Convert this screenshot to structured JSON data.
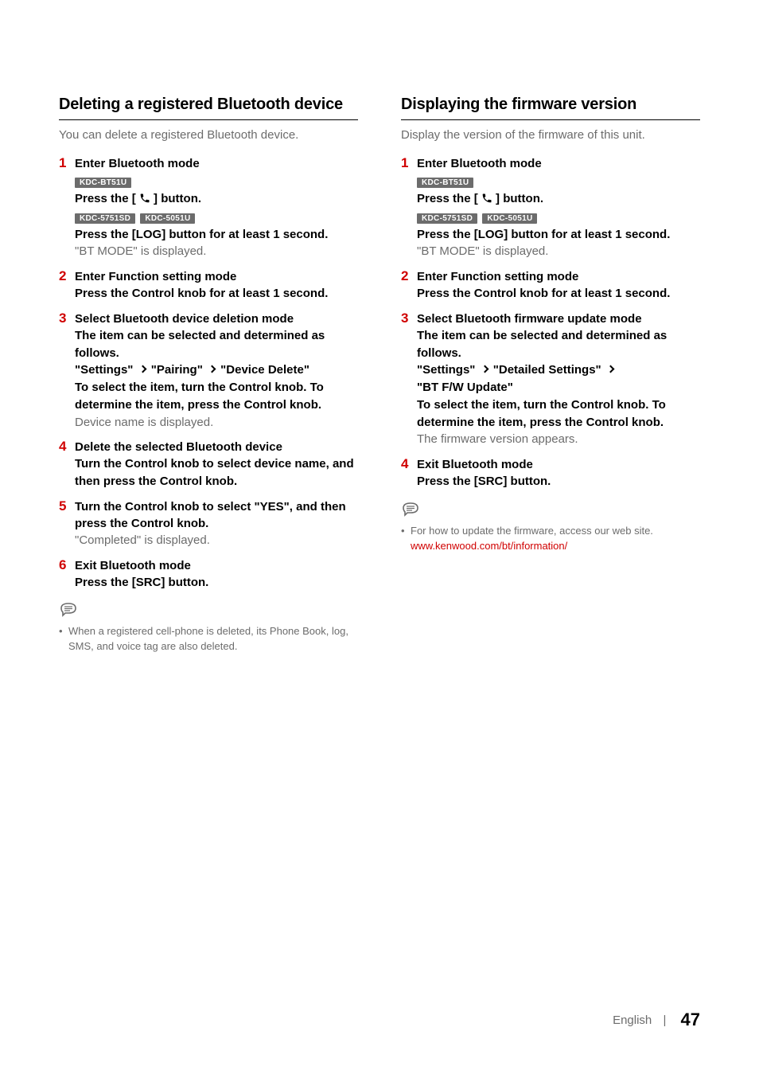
{
  "left": {
    "heading": "Deleting a registered Bluetooth device",
    "intro": "You can delete a registered Bluetooth device.",
    "steps": [
      {
        "title": "Enter Bluetooth mode",
        "badges_a": [
          "KDC-BT51U"
        ],
        "press_phone_pre": "Press the [",
        "press_phone_post": "] button.",
        "badges_b": [
          "KDC-5751SD",
          "KDC-5051U"
        ],
        "log_line": "Press the [LOG] button for at least 1 second.",
        "result": "\"BT MODE\" is displayed."
      },
      {
        "title": "Enter Function setting mode",
        "body_bold": "Press the Control knob for at least 1 second."
      },
      {
        "title": "Select Bluetooth device deletion mode",
        "body_bold": "The item can be selected and determined as follows.",
        "path": [
          "\"Settings\"",
          "\"Pairing\"",
          "\"Device Delete\""
        ],
        "body_bold2": "To select the item, turn the Control knob. To determine the item, press the Control knob.",
        "result": "Device name is displayed."
      },
      {
        "title": "Delete the selected Bluetooth device",
        "body_bold": "Turn the Control knob to select device name, and then press the Control knob."
      },
      {
        "title": "Turn the Control knob to select \"YES\", and then press the Control knob.",
        "title_wrap": true,
        "result": "\"Completed\" is displayed."
      },
      {
        "title": "Exit Bluetooth mode",
        "body_bold": "Press the [SRC] button."
      }
    ],
    "note": "When a registered cell-phone is deleted, its Phone Book, log, SMS, and voice tag are also deleted."
  },
  "right": {
    "heading": "Displaying the firmware version",
    "intro": "Display the version of the firmware of this unit.",
    "steps": [
      {
        "title": "Enter Bluetooth mode",
        "badges_a": [
          "KDC-BT51U"
        ],
        "press_phone_pre": "Press the [",
        "press_phone_post": "] button.",
        "badges_b": [
          "KDC-5751SD",
          "KDC-5051U"
        ],
        "log_line": "Press the [LOG] button for at least 1 second.",
        "result": "\"BT MODE\" is displayed."
      },
      {
        "title": "Enter Function setting mode",
        "body_bold": "Press the Control knob for at least 1 second."
      },
      {
        "title": "Select Bluetooth firmware update mode",
        "body_bold": "The item can be selected and determined as follows.",
        "path": [
          "\"Settings\"",
          "\"Detailed Settings\"",
          "\"BT F/W Update\""
        ],
        "body_bold2": "To select the item, turn the Control knob. To determine the item, press the Control knob.",
        "result": "The firmware version appears."
      },
      {
        "title": "Exit Bluetooth mode",
        "body_bold": "Press the [SRC] button."
      }
    ],
    "note_pre": "For how to update the firmware, access our web site.",
    "note_link": "www.kenwood.com/bt/information/"
  },
  "footer": {
    "language": "English",
    "separator": "|",
    "page": "47"
  }
}
